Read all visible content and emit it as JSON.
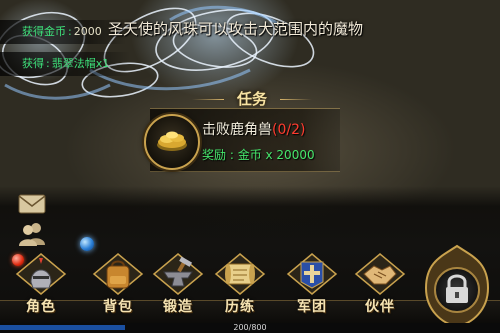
{
  "notifications": [
    {
      "label": "获得金币",
      "value": "2000"
    },
    {
      "label": "获得",
      "value": "翡翠法帽x1"
    }
  ],
  "skill_tip": "圣天使的风珠可以攻击大范围内的魔物",
  "quest": {
    "title": "任务",
    "name": "击败鹿角兽",
    "progress": "(0/2)",
    "reward_label": "奖励",
    "reward_text": "金币 x 20000",
    "icon": "gold-coins-icon"
  },
  "menu": {
    "items": [
      {
        "label": "角色",
        "icon": "knight-helmet-icon"
      },
      {
        "label": "背包",
        "icon": "backpack-icon"
      },
      {
        "label": "锻造",
        "icon": "anvil-icon"
      },
      {
        "label": "历练",
        "icon": "scroll-icon"
      },
      {
        "label": "军团",
        "icon": "cross-banner-icon"
      },
      {
        "label": "伙伴",
        "icon": "handshake-icon"
      }
    ],
    "side_buttons": [
      "mail-icon",
      "friends-icon"
    ],
    "lock_icon": "lock-icon"
  },
  "exp": {
    "text": "200/800",
    "fraction": 0.25
  },
  "colors": {
    "gold": "#f6e4b3",
    "green_text": "#45e56b",
    "progress_red": "#ff3b2f",
    "exp_blue": "#1a4fa0"
  }
}
